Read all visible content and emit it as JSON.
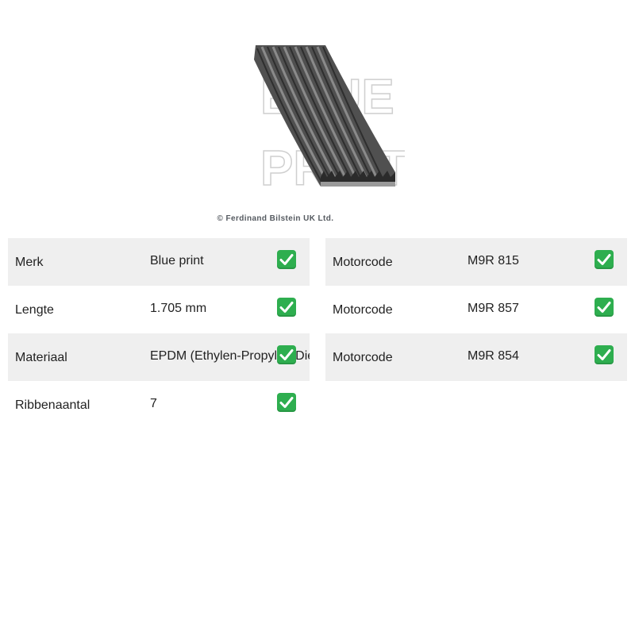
{
  "product": {
    "image_icon": "ribbed-v-belt-image",
    "watermark": "BLUE PRINT",
    "copyright": "© Ferdinand Bilstein UK Ltd."
  },
  "specs": [
    {
      "label": "Merk",
      "value": "Blue print",
      "check_icon": "check-mark-icon"
    },
    {
      "label": "Lengte",
      "value": "1.705 mm",
      "check_icon": "check-mark-icon"
    },
    {
      "label": "Materiaal",
      "value": "EPDM (Ethylen-Propylen-Dien-Kautschuk)",
      "check_icon": "check-mark-icon"
    },
    {
      "label": "Ribbenaantal",
      "value": "7",
      "check_icon": "check-mark-icon"
    }
  ],
  "engine_codes": [
    {
      "label": "Motorcode",
      "value": "M9R 815",
      "check_icon": "check-mark-icon"
    },
    {
      "label": "Motorcode",
      "value": "M9R 857",
      "check_icon": "check-mark-icon"
    },
    {
      "label": "Motorcode",
      "value": "M9R 854",
      "check_icon": "check-mark-icon"
    }
  ],
  "colors": {
    "check_green": "#2eae4f",
    "row_shade": "#efefef",
    "belt_dark": "#4a4a4a"
  }
}
